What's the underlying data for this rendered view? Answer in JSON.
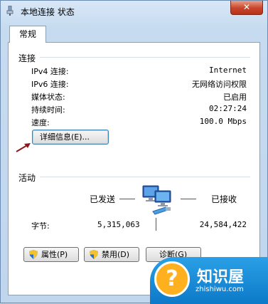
{
  "window": {
    "title": "本地连接 状态",
    "close_glyph": "✕"
  },
  "tabs": [
    {
      "label": "常规",
      "selected": true
    }
  ],
  "connection": {
    "group_label": "连接",
    "rows": [
      {
        "label": "IPv4 连接:",
        "value": "Internet"
      },
      {
        "label": "IPv6 连接:",
        "value": "无网络访问权限"
      },
      {
        "label": "媒体状态:",
        "value": "已启用"
      },
      {
        "label": "持续时间:",
        "value": "02:27:24"
      },
      {
        "label": "速度:",
        "value": "100.0 Mbps"
      }
    ],
    "details_button": "详细信息(E)..."
  },
  "activity": {
    "group_label": "活动",
    "sent_label": "已发送",
    "received_label": "已接收",
    "bytes_label": "字节:",
    "bytes_sent": "5,315,063",
    "bytes_received": "24,584,422"
  },
  "buttons": {
    "properties": "属性(P)",
    "disable": "禁用(D)",
    "diagnose": "诊断(G)"
  },
  "watermark": {
    "title": "知识屋",
    "subtitle": "zhishiwu.com"
  },
  "colors": {
    "arrow": "#8b1a1a",
    "focus_border": "#3c7fb1",
    "watermark_blue": "#1a8ad8",
    "watermark_orange": "#ffb01f"
  },
  "icons": [
    "network-adapter-icon",
    "uac-shield-icon",
    "network-computers-icon",
    "annotation-arrow-icon",
    "question-mark-icon"
  ]
}
